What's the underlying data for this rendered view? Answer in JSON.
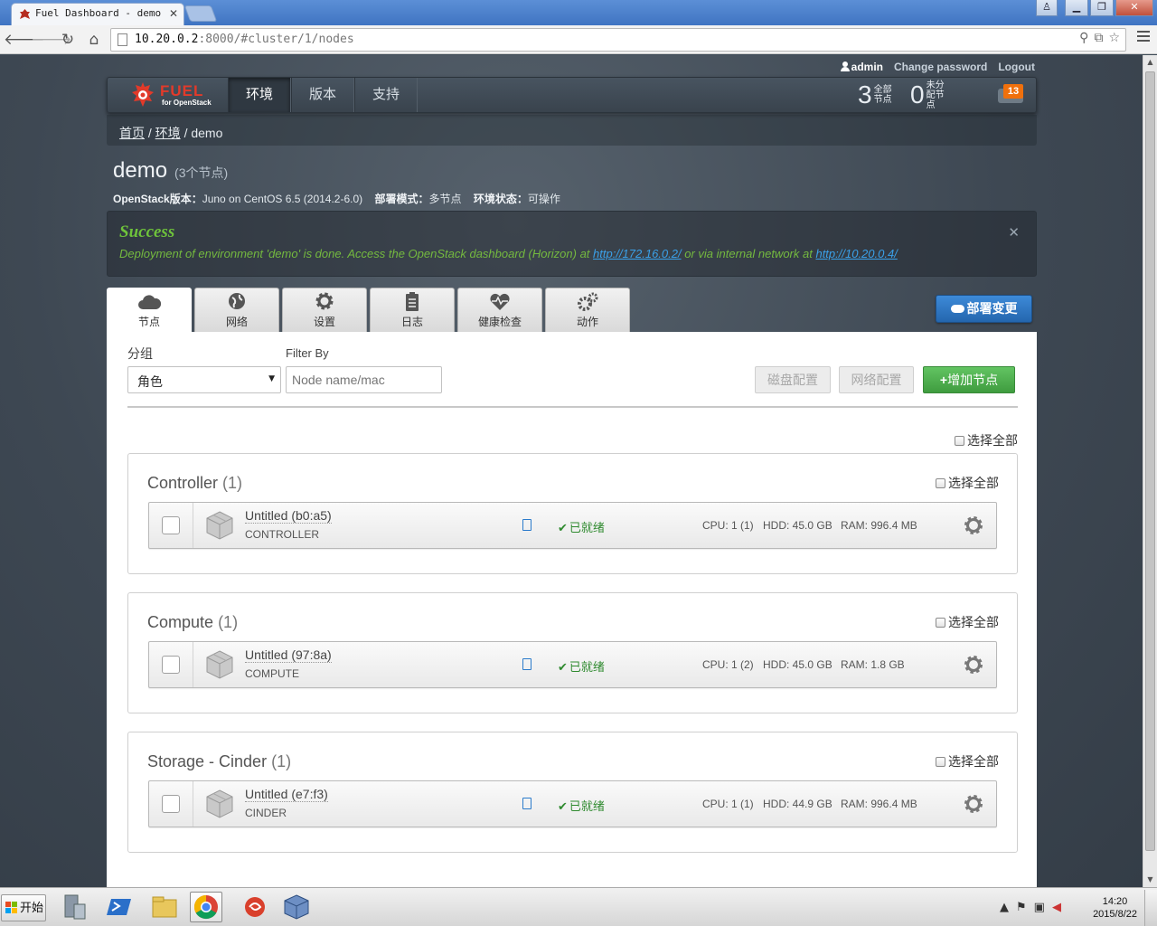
{
  "browser": {
    "tab_title": "Fuel Dashboard - demo",
    "url_host": "10.20.0.2",
    "url_path": ":8000/#cluster/1/nodes"
  },
  "userbar": {
    "username": "admin",
    "change_password": "Change password",
    "logout": "Logout"
  },
  "navbar": {
    "logo_text": "FUEL",
    "logo_sub": "for OpenStack",
    "tabs": [
      "环境",
      "版本",
      "支持"
    ],
    "stats": [
      {
        "num": "3",
        "label": "全部节点"
      },
      {
        "num": "0",
        "label": "未分配节点"
      }
    ],
    "notifications": "13"
  },
  "breadcrumb": {
    "home": "首页",
    "envs": "环境",
    "current": "demo"
  },
  "cluster": {
    "name": "demo",
    "count": "(3个节点)",
    "openstack_label": "OpenStack版本：",
    "openstack_value": "Juno on CentOS 6.5 (2014.2-6.0)",
    "mode_label": "部署模式：",
    "mode_value": "多节点",
    "status_label": "环境状态：",
    "status_value": "可操作"
  },
  "alert": {
    "title": "Success",
    "text_before": "Deployment of environment 'demo' is done. Access the OpenStack dashboard (Horizon) at ",
    "link1": "http://172.16.0.2/",
    "text_middle": " or via internal network at ",
    "link2": "http://10.20.0.4/"
  },
  "subtabs": [
    "节点",
    "网络",
    "设置",
    "日志",
    "健康检查",
    "动作"
  ],
  "deploy_button": "部署变更",
  "filters": {
    "group_label": "分组",
    "group_value": "角色",
    "filter_label": "Filter By",
    "filter_placeholder": "Node name/mac",
    "disk_btn": "磁盘配置",
    "net_btn": "网络配置",
    "add_btn": "增加节点"
  },
  "select_all": "选择全部",
  "groups": [
    {
      "title": "Controller",
      "count": "(1)",
      "node": {
        "name": "Untitled (b0:a5)",
        "role": "CONTROLLER",
        "status": "已就绪",
        "cpu": "CPU: 1 (1)",
        "hdd": "HDD: 45.0 GB",
        "ram": "RAM: 996.4 MB"
      }
    },
    {
      "title": "Compute",
      "count": "(1)",
      "node": {
        "name": "Untitled (97:8a)",
        "role": "COMPUTE",
        "status": "已就绪",
        "cpu": "CPU: 1 (2)",
        "hdd": "HDD: 45.0 GB",
        "ram": "RAM: 1.8 GB"
      }
    },
    {
      "title": "Storage - Cinder",
      "count": "(1)",
      "node": {
        "name": "Untitled (e7:f3)",
        "role": "CINDER",
        "status": "已就绪",
        "cpu": "CPU: 1 (1)",
        "hdd": "HDD: 44.9 GB",
        "ram": "RAM: 996.4 MB"
      }
    }
  ],
  "taskbar": {
    "start": "开始",
    "time": "14:20",
    "date": "2015/8/22"
  },
  "colors": {
    "success_green": "#6ec23b",
    "link_blue": "#3aa0e8",
    "deploy_blue": "#2f78c4",
    "add_green": "#4fae4f",
    "badge_orange": "#f0700c",
    "logo_red": "#e23a2a"
  }
}
